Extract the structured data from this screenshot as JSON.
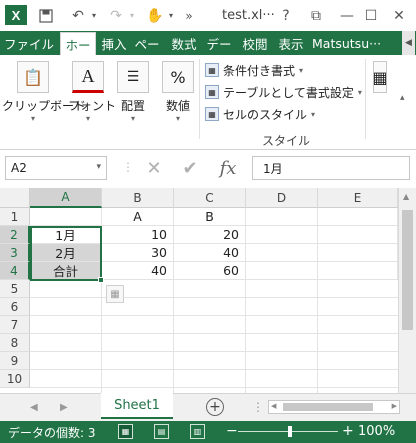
{
  "window": {
    "title": "test.xl···",
    "app_logo": "X"
  },
  "titlebar_icons": {
    "save": "save-icon",
    "undo": "undo-icon",
    "redo": "redo-icon",
    "touch": "touch-mode-icon",
    "help": "?",
    "restore": "⧉",
    "minimize": "—",
    "close": "✕"
  },
  "tabs": [
    {
      "label": "ファイル"
    },
    {
      "label": "ホー"
    },
    {
      "label": "挿入"
    },
    {
      "label": "ペー"
    },
    {
      "label": "数式"
    },
    {
      "label": "デー"
    },
    {
      "label": "校閲"
    },
    {
      "label": "表示"
    },
    {
      "label": "Matsutsu···"
    }
  ],
  "ribbon": {
    "clipboard": "クリップボード",
    "font": "フォント",
    "font_icon": "A",
    "alignment": "配置",
    "number": "数値",
    "number_icon": "%",
    "conditional_format": "条件付き書式",
    "format_as_table": "テーブルとして書式設定",
    "cell_styles": "セルのスタイル",
    "styles_group": "スタイル"
  },
  "formula_bar": {
    "name_box": "A2",
    "cancel": "✕",
    "enter": "✔",
    "fx": "fx",
    "value": "1月"
  },
  "columns": [
    "A",
    "B",
    "C",
    "D",
    "E"
  ],
  "rows": [
    "1",
    "2",
    "3",
    "4",
    "5",
    "6",
    "7",
    "8",
    "9",
    "10"
  ],
  "cells": {
    "B1": "A",
    "C1": "B",
    "A2": "1月",
    "B2": "10",
    "C2": "20",
    "A3": "2月",
    "B3": "30",
    "C3": "40",
    "A4": "合計",
    "B4": "40",
    "C4": "60"
  },
  "sheet_tabs": [
    {
      "label": "Sheet1"
    }
  ],
  "status": {
    "text": "データの個数: 3",
    "zoom": "100%"
  }
}
